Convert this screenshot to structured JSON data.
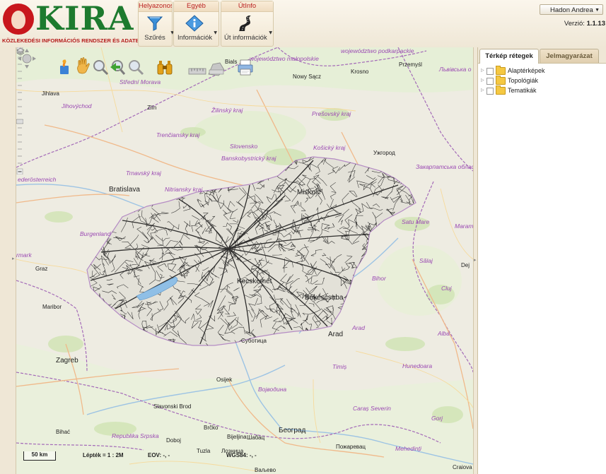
{
  "header": {
    "logo_text": "KIRA",
    "logo_subtitle": "KÖZLEKEDÉSI INFORMÁCIÓS RENDSZER ÉS ADATBÁZIS",
    "ribbon": {
      "groups": [
        {
          "title": "Helyazonosí",
          "buttons": [
            {
              "label": "Szűrés",
              "icon": "filter-icon"
            }
          ]
        },
        {
          "title": "Egyéb",
          "buttons": [
            {
              "label": "Információk",
              "icon": "info-icon"
            }
          ]
        },
        {
          "title": "ÚtInfo",
          "buttons": [
            {
              "label": "Út információk",
              "icon": "road-icon"
            }
          ]
        }
      ]
    },
    "user": {
      "name": "Hadon Andrea"
    },
    "version": {
      "label": "Verzió:",
      "value": "1.1.13"
    }
  },
  "map": {
    "labels": {
      "regions": [
        "województwo małopolskie",
        "województwo podkarpackie",
        "Střední Morava",
        "Jihovýchod",
        "Žilinský kraj",
        "Prešovský kraj",
        "Trenčiansky kraj",
        "Košický kraj",
        "Slovensko",
        "Banskobystrický kraj",
        "Trnavský kraj",
        "Nitriansky kraj",
        "Закарпатська область",
        "Львівська о",
        "Burgenland",
        "Satu Mare",
        "Maram",
        "Sălaj",
        "Bihor",
        "Cluj",
        "Arad",
        "Alba",
        "Timiș",
        "Hunedoara",
        "Caraș Severin",
        "Gorj",
        "Mehedinți",
        "Republika Srpska",
        "Војводина"
      ],
      "cities": [
        "Nowy Sącz",
        "Krosno",
        "Przemyśl",
        "Zlín",
        "Jihlava",
        "Ужгород",
        "Graz",
        "Maribor",
        "Osijek",
        "Slavonski Brod",
        "Brčko",
        "Bijeljina",
        "Шабац",
        "Tuzla",
        "Лозница",
        "Doboj",
        "Bihać",
        "Ваљево",
        "Пожаревац",
        "Суботица",
        "Dej",
        "Craiova"
      ],
      "big_cities": [
        "Bratislava",
        "Miskolc",
        "Kecskemét",
        "Békéscsaba",
        "Arad",
        "Zagreb",
        "Београд"
      ],
      "partial": [
        "ederösterreich",
        "rmark",
        "Bials"
      ]
    },
    "scalebar": "50 km",
    "scale": {
      "label": "Lépték",
      "value": "1 : 2M"
    },
    "eov": {
      "label": "EOV:",
      "value": "-, -"
    },
    "wgs84": {
      "label": "WGS84:",
      "value": "-, -"
    }
  },
  "right_panel": {
    "tabs": [
      {
        "label": "Térkép rétegek",
        "active": true
      },
      {
        "label": "Jelmagyarázat",
        "active": false
      }
    ],
    "tree": [
      {
        "label": "Alaptérképek"
      },
      {
        "label": "Topológiák"
      },
      {
        "label": "Tematikák"
      }
    ]
  },
  "colors": {
    "brand_green": "#1d7a2e",
    "brand_red": "#c8171d",
    "region_label": "#9b4ab3"
  }
}
